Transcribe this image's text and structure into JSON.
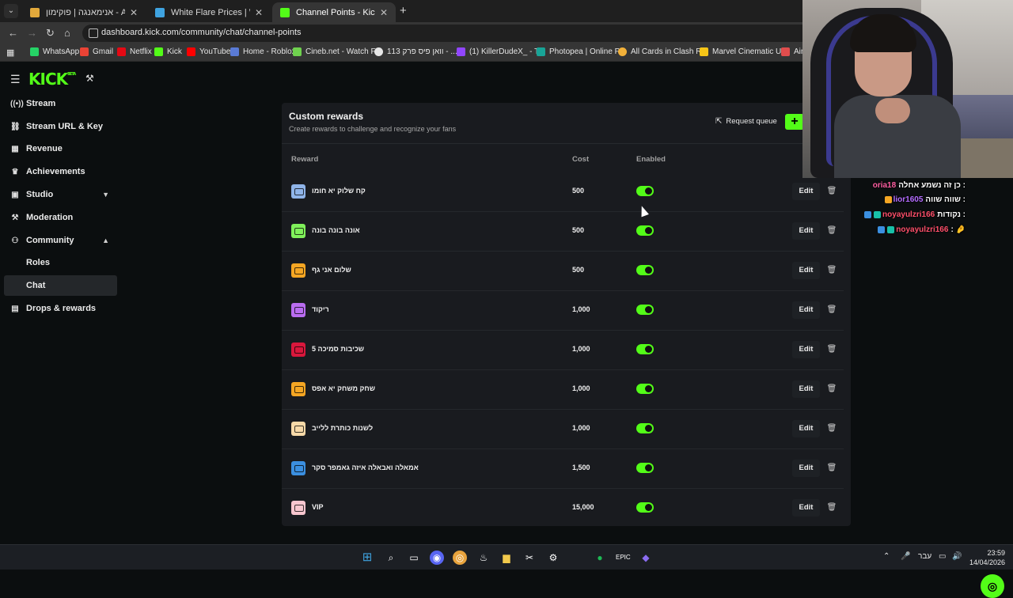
{
  "browser": {
    "tabs": [
      {
        "title": "אנימאנגה | פוקימון - Animanga",
        "color": "#e2a93b",
        "active": false
      },
      {
        "title": "White Flare Prices | White Flare",
        "color": "#3fa3e0",
        "active": false
      },
      {
        "title": "Channel Points - Kick Dashboard",
        "color": "#53fc18",
        "active": true
      }
    ],
    "url": "dashboard.kick.com/community/chat/channel-points",
    "bookmarks": [
      {
        "label": "WhatsApp",
        "color": "#25d366"
      },
      {
        "label": "Gmail",
        "color": "#ea4335"
      },
      {
        "label": "Netflix",
        "color": "#e50914"
      },
      {
        "label": "Kick",
        "color": "#53fc18"
      },
      {
        "label": "YouTube",
        "color": "#ff0000"
      },
      {
        "label": "Home - Roblox",
        "color": "#5a7bd6"
      },
      {
        "label": "Cineb.net - Watch F...",
        "color": "#6fd14e"
      },
      {
        "label": "וואן פיס פרק 113 - ...",
        "color": "#e6e6e6"
      },
      {
        "label": "(1) KillerDudeX_ - T...",
        "color": "#9146ff"
      },
      {
        "label": "Photopea | Online P...",
        "color": "#18a497"
      },
      {
        "label": "All Cards in Clash R...",
        "color": "#f2b13a"
      },
      {
        "label": "Marvel Cinematic U...",
        "color": "#f5c518"
      },
      {
        "label": "Aim",
        "color": "#e04d4d"
      }
    ]
  },
  "sidebar": {
    "logo": "KICK",
    "logo_sup": "BETA",
    "items": [
      {
        "label": "Stream",
        "icon": "(•)"
      },
      {
        "label": "Stream URL & Key",
        "icon": "⛓"
      },
      {
        "label": "Revenue",
        "icon": "▦"
      },
      {
        "label": "Achievements",
        "icon": "🏆"
      },
      {
        "label": "Studio",
        "icon": "▣"
      },
      {
        "label": "Moderation",
        "icon": "🔨"
      },
      {
        "label": "Community",
        "icon": "👥"
      },
      {
        "label": "Roles",
        "icon": ""
      },
      {
        "label": "Chat",
        "icon": ""
      },
      {
        "label": "Drops & rewards",
        "icon": "▤"
      }
    ]
  },
  "panel": {
    "title": "Custom rewards",
    "subtitle": "Create rewards to challenge and recognize your fans",
    "request_queue": "Request queue",
    "add": "+",
    "headers": {
      "reward": "Reward",
      "cost": "Cost",
      "enabled": "Enabled"
    },
    "rewards": [
      {
        "name": "קח שלוק יא חומו",
        "cost": "500",
        "color": "#8fb4e8",
        "enabled": true,
        "edit": "Edit"
      },
      {
        "name": "אונה בונה בונה",
        "cost": "500",
        "color": "#7ff05a",
        "enabled": true,
        "edit": "Edit"
      },
      {
        "name": "שלום אני גף",
        "cost": "500",
        "color": "#f5a623",
        "enabled": true,
        "edit": "Edit"
      },
      {
        "name": "ריקוד",
        "cost": "1,000",
        "color": "#b96cf0",
        "enabled": true,
        "edit": "Edit"
      },
      {
        "name": "5 שכיבות סמיכה",
        "cost": "1,000",
        "color": "#d9173c",
        "enabled": true,
        "edit": "Edit"
      },
      {
        "name": "שחק משחק יא אפס",
        "cost": "1,000",
        "color": "#f5a623",
        "enabled": true,
        "edit": "Edit"
      },
      {
        "name": "לשנות כותרת ללייב",
        "cost": "1,000",
        "color": "#f7d9a8",
        "enabled": true,
        "edit": "Edit"
      },
      {
        "name": "אמאלה ואבאלה איזה גאמפר סקר",
        "cost": "1,500",
        "color": "#3b8fe0",
        "enabled": true,
        "edit": "Edit"
      },
      {
        "name": "VIP",
        "cost": "15,000",
        "color": "#f7c6cf",
        "enabled": true,
        "edit": "Edit"
      }
    ]
  },
  "chat": [
    {
      "message": "כן זה נשמע אחלה :",
      "user": "oria18",
      "color": "#ff5fa2"
    },
    {
      "message": "שווה שווה :",
      "user": "lior1605",
      "color": "#b46cff"
    },
    {
      "message": "נקודות :",
      "user": "noyayulzri166",
      "color": "#ff4f6a"
    },
    {
      "message": ": 🤌",
      "user": "noyayulzri166",
      "color": "#ff4f6a"
    }
  ],
  "taskbar": {
    "time": "23:59",
    "date": "14/04/2026",
    "lang": "עבר"
  }
}
